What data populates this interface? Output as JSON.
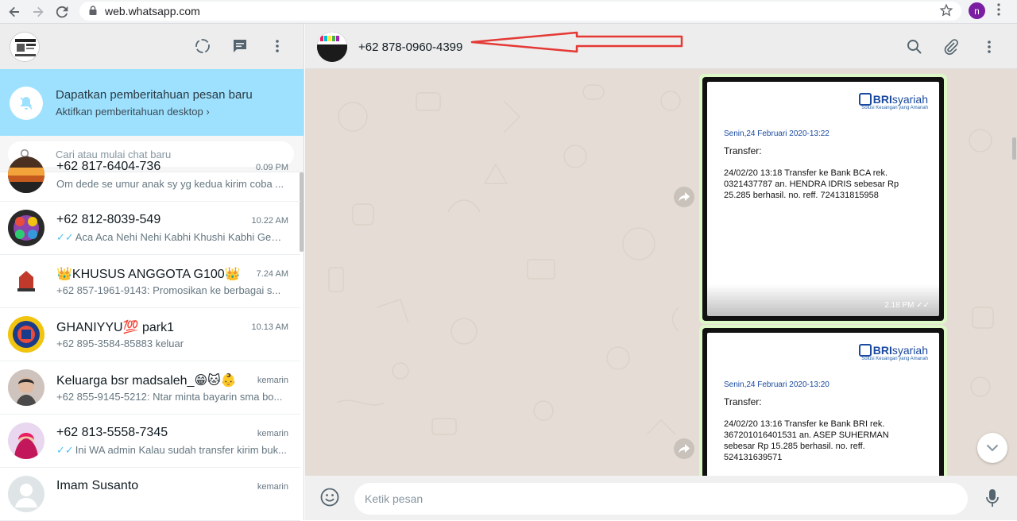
{
  "browser": {
    "url": "web.whatsapp.com",
    "profile_initial": "n"
  },
  "notification": {
    "title": "Dapatkan pemberitahuan pesan baru",
    "subtitle": "Aktifkan pemberitahuan desktop ›"
  },
  "search": {
    "placeholder": "Cari atau mulai chat baru"
  },
  "chats": [
    {
      "name": "+62 817-6404-736",
      "time": "0.09 PM",
      "message": "Om dede se umur anak sy yg kedua kirim coba ...",
      "ticks": ""
    },
    {
      "name": "+62 812-8039-549",
      "time": "10.22 AM",
      "message": "Aca Aca Nehi Nehi Kabhi Khushi Kabhi Gem...",
      "ticks": "✓✓"
    },
    {
      "name": "👑KHUSUS ANGGOTA G100👑",
      "time": "7.24 AM",
      "message": "+62 857-1961-9143: Promosikan ke berbagai s...",
      "ticks": ""
    },
    {
      "name": "GHANIYYU💯 park1",
      "time": "10.13 AM",
      "message": "+62 895-3584-85883 keluar",
      "ticks": ""
    },
    {
      "name": "Keluarga bsr madsaleh_😁🐱👶",
      "time": "kemarin",
      "message": "+62 855-9145-5212: Ntar minta bayarin sma bo...",
      "ticks": ""
    },
    {
      "name": "+62 813-5558-7345",
      "time": "kemarin",
      "message": "Ini WA admin Kalau sudah transfer kirim buk...",
      "ticks": "✓✓"
    },
    {
      "name": "Imam Susanto",
      "time": "kemarin",
      "message": "",
      "ticks": ""
    }
  ],
  "conversation": {
    "contact_name": "+62 878-0960-4399"
  },
  "messages": [
    {
      "brand": "BRI",
      "brand_suffix": "syariah",
      "tagline": "Solusi Keuangan yang Amanah",
      "date": "Senin,24 Februari 2020-13:22",
      "label": "Transfer:",
      "body": "24/02/20 13:18 Transfer ke Bank BCA rek. 0321437787 an. HENDRA IDRIS sebesar Rp 25.285 berhasil. no. reff. 724131815958",
      "time": "2.18 PM ✓✓"
    },
    {
      "brand": "BRI",
      "brand_suffix": "syariah",
      "tagline": "Solusi Keuangan yang Amanah",
      "date": "Senin,24 Februari 2020-13:20",
      "label": "Transfer:",
      "body": "24/02/20 13:16 Transfer ke Bank BRI rek. 367201016401531 an. ASEP SUHERMAN sebesar Rp 15.285 berhasil. no. reff. 524131639571",
      "time": ""
    }
  ],
  "compose": {
    "placeholder": "Ketik pesan"
  },
  "colors": {
    "notification_bg": "#9de1fe",
    "chat_bg": "#e5ddd5",
    "bubble_out": "#dcf8c6",
    "annotation_arrow": "#e53935"
  }
}
